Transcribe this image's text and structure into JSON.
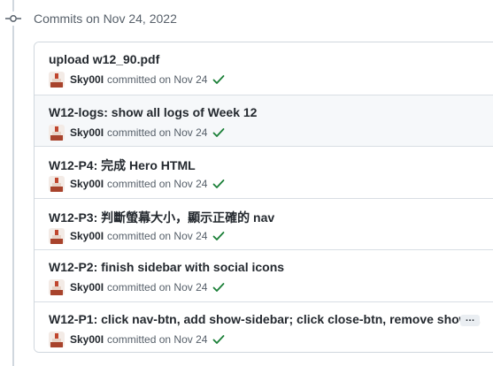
{
  "group": {
    "title": "Commits on Nov 24, 2022"
  },
  "commits": [
    {
      "title": "upload w12_90.pdf",
      "author": "Sky00I",
      "committed": "committed on Nov 24"
    },
    {
      "title": "W12-logs: show all logs of Week 12",
      "author": "Sky00I",
      "committed": "committed on Nov 24"
    },
    {
      "title": "W12-P4: 完成 Hero HTML",
      "author": "Sky00I",
      "committed": "committed on Nov 24"
    },
    {
      "title": "W12-P3: 判斷螢幕大小，顯示正確的 nav",
      "author": "Sky00I",
      "committed": "committed on Nov 24"
    },
    {
      "title": "W12-P2: finish sidebar with social icons",
      "author": "Sky00I",
      "committed": "committed on Nov 24"
    },
    {
      "title": "W12-P1: click nav-btn, add show-sidebar; click close-btn, remove show…",
      "author": "Sky00I",
      "committed": "committed on Nov 24",
      "ellipsis": "…"
    }
  ],
  "colors": {
    "check_green": "#1a7f37",
    "muted_text": "#57606a",
    "border": "#d0d7de",
    "highlight_row": "#f6f8fa"
  },
  "icons": {
    "timeline": "git-commit-icon",
    "status": "check-icon",
    "avatar": "user-avatar"
  }
}
